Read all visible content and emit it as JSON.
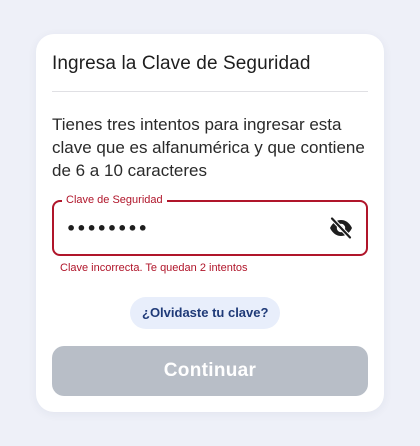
{
  "dialog": {
    "title": "Ingresa la Clave de Seguridad",
    "description": "Tienes tres intentos para ingresar esta clave que es alfanumérica y que contiene de 6 a 10 caracteres",
    "field": {
      "label": "Clave de Seguridad",
      "value": "••••••••",
      "icon": "eye-slash-icon"
    },
    "error": "Clave incorrecta. Te quedan 2 intentos",
    "forgot_label": "¿Olvidaste tu clave?",
    "continue_label": "Continuar"
  },
  "colors": {
    "background": "#eef0f8",
    "error": "#b0152a",
    "link": "#1f3a78",
    "link_bg": "#e8eefb",
    "disabled_button": "#b8bec7"
  }
}
